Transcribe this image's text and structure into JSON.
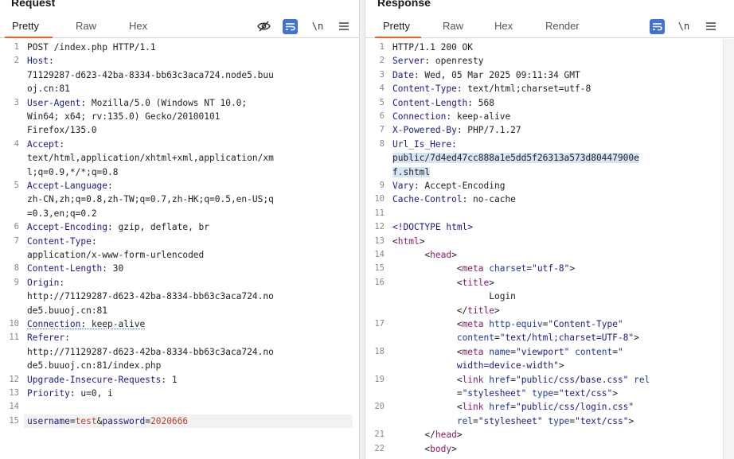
{
  "request": {
    "title": "Request",
    "tabs": [
      "Pretty",
      "Raw",
      "Hex"
    ],
    "active_tab": "Pretty",
    "newline_label": "\\n",
    "lines": [
      {
        "n": "1",
        "segs": [
          {
            "t": "POST /index.php HTTP/1.1",
            "c": "txt"
          }
        ]
      },
      {
        "n": "2",
        "segs": [
          {
            "t": "Host",
            "c": "hdr"
          },
          {
            "t": ":",
            "c": "txt"
          }
        ]
      },
      {
        "n": "",
        "segs": [
          {
            "t": "71129287-d623-42ba-8334-bb63c3aca724.node5.buu",
            "c": "txt"
          }
        ]
      },
      {
        "n": "",
        "segs": [
          {
            "t": "oj.cn:81",
            "c": "txt"
          }
        ]
      },
      {
        "n": "3",
        "segs": [
          {
            "t": "User-Agent",
            "c": "hdr"
          },
          {
            "t": ": Mozilla/5.0 (Windows NT 10.0;",
            "c": "txt"
          }
        ]
      },
      {
        "n": "",
        "segs": [
          {
            "t": "Win64; x64; rv:135.0) Gecko/20100101",
            "c": "txt"
          }
        ]
      },
      {
        "n": "",
        "segs": [
          {
            "t": "Firefox/135.0",
            "c": "txt"
          }
        ]
      },
      {
        "n": "4",
        "segs": [
          {
            "t": "Accept",
            "c": "hdr"
          },
          {
            "t": ":",
            "c": "txt"
          }
        ]
      },
      {
        "n": "",
        "segs": [
          {
            "t": "text/html,application/xhtml+xml,application/xm",
            "c": "txt"
          }
        ]
      },
      {
        "n": "",
        "segs": [
          {
            "t": "l;q=0.9,*/*;q=0.8",
            "c": "txt"
          }
        ]
      },
      {
        "n": "5",
        "segs": [
          {
            "t": "Accept-Language",
            "c": "hdr"
          },
          {
            "t": ":",
            "c": "txt"
          }
        ]
      },
      {
        "n": "",
        "segs": [
          {
            "t": "zh-CN,zh;q=0.8,zh-TW;q=0.7,zh-HK;q=0.5,en-US;q",
            "c": "txt"
          }
        ]
      },
      {
        "n": "",
        "segs": [
          {
            "t": "=0.3,en;q=0.2",
            "c": "txt"
          }
        ]
      },
      {
        "n": "6",
        "segs": [
          {
            "t": "Accept-Encoding",
            "c": "hdr"
          },
          {
            "t": ": gzip, deflate, br",
            "c": "txt"
          }
        ]
      },
      {
        "n": "7",
        "segs": [
          {
            "t": "Content-Type",
            "c": "hdr"
          },
          {
            "t": ":",
            "c": "txt"
          }
        ]
      },
      {
        "n": "",
        "segs": [
          {
            "t": "application/x-www-form-urlencoded",
            "c": "txt"
          }
        ]
      },
      {
        "n": "8",
        "segs": [
          {
            "t": "Content-Length",
            "c": "hdr"
          },
          {
            "t": ": 30",
            "c": "txt"
          }
        ]
      },
      {
        "n": "9",
        "segs": [
          {
            "t": "Origin",
            "c": "hdr"
          },
          {
            "t": ":",
            "c": "txt"
          }
        ]
      },
      {
        "n": "",
        "segs": [
          {
            "t": "http://71129287-d623-42ba-8334-bb63c3aca724.no",
            "c": "txt"
          }
        ]
      },
      {
        "n": "",
        "segs": [
          {
            "t": "de5.buuoj.cn:81",
            "c": "txt"
          }
        ]
      },
      {
        "n": "10",
        "segs": [
          {
            "t": "Connection",
            "c": "hdr dotted"
          },
          {
            "t": ": keep-alive",
            "c": "txt dotted"
          }
        ]
      },
      {
        "n": "11",
        "segs": [
          {
            "t": "Referer",
            "c": "hdr"
          },
          {
            "t": ":",
            "c": "txt"
          }
        ]
      },
      {
        "n": "",
        "segs": [
          {
            "t": "http://71129287-d623-42ba-8334-bb63c3aca724.no",
            "c": "txt"
          }
        ]
      },
      {
        "n": "",
        "segs": [
          {
            "t": "de5.buuoj.cn:81/index.php",
            "c": "txt"
          }
        ]
      },
      {
        "n": "12",
        "segs": [
          {
            "t": "Upgrade-Insecure-Requests",
            "c": "hdr"
          },
          {
            "t": ": 1",
            "c": "txt"
          }
        ]
      },
      {
        "n": "13",
        "segs": [
          {
            "t": "Priority",
            "c": "hdr"
          },
          {
            "t": ": u=0, i",
            "c": "txt"
          }
        ]
      },
      {
        "n": "14",
        "segs": []
      },
      {
        "n": "15",
        "hl": true,
        "segs": [
          {
            "t": "username",
            "c": "pname"
          },
          {
            "t": "=",
            "c": "txt"
          },
          {
            "t": "test",
            "c": "pval"
          },
          {
            "t": "&",
            "c": "txt"
          },
          {
            "t": "password",
            "c": "pname"
          },
          {
            "t": "=",
            "c": "txt"
          },
          {
            "t": "2020666",
            "c": "pval"
          }
        ]
      }
    ]
  },
  "response": {
    "title": "Response",
    "tabs": [
      "Pretty",
      "Raw",
      "Hex",
      "Render"
    ],
    "active_tab": "Pretty",
    "newline_label": "\\n",
    "lines": [
      {
        "n": "1",
        "segs": [
          {
            "t": "HTTP/1.1 200 OK",
            "c": "txt"
          }
        ]
      },
      {
        "n": "2",
        "segs": [
          {
            "t": "Server",
            "c": "hdr"
          },
          {
            "t": ": openresty",
            "c": "txt"
          }
        ]
      },
      {
        "n": "3",
        "segs": [
          {
            "t": "Date",
            "c": "hdr"
          },
          {
            "t": ": Wed, 05 Mar 2025 09:11:34 GMT",
            "c": "txt"
          }
        ]
      },
      {
        "n": "4",
        "segs": [
          {
            "t": "Content-Type",
            "c": "hdr"
          },
          {
            "t": ": text/html;charset=utf-8",
            "c": "txt"
          }
        ]
      },
      {
        "n": "5",
        "segs": [
          {
            "t": "Content-Length",
            "c": "hdr"
          },
          {
            "t": ": 568",
            "c": "txt"
          }
        ]
      },
      {
        "n": "6",
        "segs": [
          {
            "t": "Connection",
            "c": "hdr"
          },
          {
            "t": ": keep-alive",
            "c": "txt"
          }
        ]
      },
      {
        "n": "7",
        "segs": [
          {
            "t": "X-Powered-By",
            "c": "hdr"
          },
          {
            "t": ": PHP/7.1.27",
            "c": "txt"
          }
        ]
      },
      {
        "n": "8",
        "segs": [
          {
            "t": "Url_Is_Here",
            "c": "hdr"
          },
          {
            "t": ":",
            "c": "txt"
          }
        ]
      },
      {
        "n": "",
        "segs": [
          {
            "t": "public/7d4ed47cc888a1e5dd5f26313a573d80447900e",
            "c": "txt sel"
          }
        ]
      },
      {
        "n": "",
        "segs": [
          {
            "t": "f.shtml",
            "c": "txt sel"
          }
        ]
      },
      {
        "n": "9",
        "segs": [
          {
            "t": "Vary",
            "c": "hdr"
          },
          {
            "t": ": Accept-Encoding",
            "c": "txt"
          }
        ]
      },
      {
        "n": "10",
        "segs": [
          {
            "t": "Cache-Control",
            "c": "hdr"
          },
          {
            "t": ": no-cache",
            "c": "txt"
          }
        ]
      },
      {
        "n": "11",
        "segs": []
      },
      {
        "n": "12",
        "segs": [
          {
            "t": "<!DOCTYPE html>",
            "c": "str"
          }
        ]
      },
      {
        "n": "13",
        "segs": [
          {
            "t": "<",
            "c": "txt"
          },
          {
            "t": "html",
            "c": "tagc"
          },
          {
            "t": ">",
            "c": "txt"
          }
        ]
      },
      {
        "n": "14",
        "segs": [
          {
            "t": "      <",
            "c": "txt"
          },
          {
            "t": "head",
            "c": "tagc"
          },
          {
            "t": ">",
            "c": "txt"
          }
        ]
      },
      {
        "n": "15",
        "segs": [
          {
            "t": "            <",
            "c": "txt"
          },
          {
            "t": "meta",
            "c": "tagc"
          },
          {
            "t": " ",
            "c": "txt"
          },
          {
            "t": "charset",
            "c": "attr"
          },
          {
            "t": "=",
            "c": "txt"
          },
          {
            "t": "\"utf-8\"",
            "c": "str"
          },
          {
            "t": ">",
            "c": "txt"
          }
        ]
      },
      {
        "n": "16",
        "segs": [
          {
            "t": "            <",
            "c": "txt"
          },
          {
            "t": "title",
            "c": "tagc"
          },
          {
            "t": ">",
            "c": "txt"
          }
        ]
      },
      {
        "n": "",
        "segs": [
          {
            "t": "                  Login",
            "c": "txt"
          }
        ]
      },
      {
        "n": "",
        "segs": [
          {
            "t": "            </",
            "c": "txt"
          },
          {
            "t": "title",
            "c": "tagc"
          },
          {
            "t": ">",
            "c": "txt"
          }
        ]
      },
      {
        "n": "17",
        "segs": [
          {
            "t": "            <",
            "c": "txt"
          },
          {
            "t": "meta",
            "c": "tagc"
          },
          {
            "t": " ",
            "c": "txt"
          },
          {
            "t": "http-equiv",
            "c": "attr"
          },
          {
            "t": "=",
            "c": "txt"
          },
          {
            "t": "\"Content-Type\"",
            "c": "str"
          }
        ]
      },
      {
        "n": "",
        "segs": [
          {
            "t": "            ",
            "c": "txt"
          },
          {
            "t": "content",
            "c": "attr"
          },
          {
            "t": "=",
            "c": "txt"
          },
          {
            "t": "\"text/html;charset=UTF-8\"",
            "c": "str"
          },
          {
            "t": ">",
            "c": "txt"
          }
        ]
      },
      {
        "n": "18",
        "segs": [
          {
            "t": "            <",
            "c": "txt"
          },
          {
            "t": "meta",
            "c": "tagc"
          },
          {
            "t": " ",
            "c": "txt"
          },
          {
            "t": "name",
            "c": "attr"
          },
          {
            "t": "=",
            "c": "txt"
          },
          {
            "t": "\"viewport\"",
            "c": "str"
          },
          {
            "t": " ",
            "c": "txt"
          },
          {
            "t": "content",
            "c": "attr"
          },
          {
            "t": "=",
            "c": "txt"
          },
          {
            "t": "\"",
            "c": "str"
          }
        ]
      },
      {
        "n": "",
        "segs": [
          {
            "t": "            width=device-width\"",
            "c": "str"
          },
          {
            "t": ">",
            "c": "txt"
          }
        ]
      },
      {
        "n": "19",
        "segs": [
          {
            "t": "            <",
            "c": "txt"
          },
          {
            "t": "link",
            "c": "tagc"
          },
          {
            "t": " ",
            "c": "txt"
          },
          {
            "t": "href",
            "c": "attr"
          },
          {
            "t": "=",
            "c": "txt"
          },
          {
            "t": "\"public/css/base.css\"",
            "c": "str"
          },
          {
            "t": " ",
            "c": "txt"
          },
          {
            "t": "rel",
            "c": "attr"
          }
        ]
      },
      {
        "n": "",
        "segs": [
          {
            "t": "            =",
            "c": "txt"
          },
          {
            "t": "\"stylesheet\"",
            "c": "str"
          },
          {
            "t": " ",
            "c": "txt"
          },
          {
            "t": "type",
            "c": "attr"
          },
          {
            "t": "=",
            "c": "txt"
          },
          {
            "t": "\"text/css\"",
            "c": "str"
          },
          {
            "t": ">",
            "c": "txt"
          }
        ]
      },
      {
        "n": "20",
        "segs": [
          {
            "t": "            <",
            "c": "txt"
          },
          {
            "t": "link",
            "c": "tagc"
          },
          {
            "t": " ",
            "c": "txt"
          },
          {
            "t": "href",
            "c": "attr"
          },
          {
            "t": "=",
            "c": "txt"
          },
          {
            "t": "\"public/css/login.css\"",
            "c": "str"
          }
        ]
      },
      {
        "n": "",
        "segs": [
          {
            "t": "            ",
            "c": "txt"
          },
          {
            "t": "rel",
            "c": "attr"
          },
          {
            "t": "=",
            "c": "txt"
          },
          {
            "t": "\"stylesheet\"",
            "c": "str"
          },
          {
            "t": " ",
            "c": "txt"
          },
          {
            "t": "type",
            "c": "attr"
          },
          {
            "t": "=",
            "c": "txt"
          },
          {
            "t": "\"text/css\"",
            "c": "str"
          },
          {
            "t": ">",
            "c": "txt"
          }
        ]
      },
      {
        "n": "21",
        "segs": [
          {
            "t": "      </",
            "c": "txt"
          },
          {
            "t": "head",
            "c": "tagc"
          },
          {
            "t": ">",
            "c": "txt"
          }
        ]
      },
      {
        "n": "22",
        "segs": [
          {
            "t": "      <",
            "c": "txt"
          },
          {
            "t": "body",
            "c": "tagc"
          },
          {
            "t": ">",
            "c": "txt"
          }
        ]
      }
    ]
  },
  "icons": {
    "hide_nonprintable": "eye-slash-icon",
    "wrap": "wrap-lines-icon",
    "menu": "hamburger-menu-icon"
  },
  "colors": {
    "accent_underline": "#e8612c",
    "toggle_blue": "#3f74d6",
    "header_name": "#1a1a8a",
    "param_value": "#c0392b",
    "selection": "#d6e4f6"
  }
}
